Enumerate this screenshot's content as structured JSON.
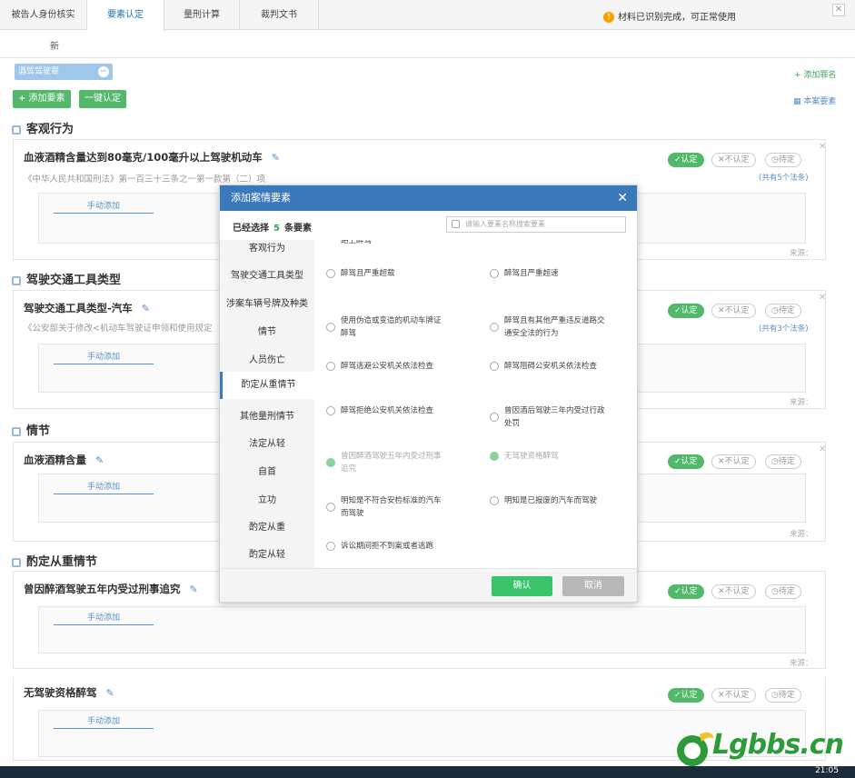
{
  "tabs": [
    "被告人身份核实",
    "要素认定",
    "量刑计算",
    "裁判文书"
  ],
  "notice": "材料已识别完成，可正常使用",
  "subtab": "新",
  "chip": "酒驾驾驶罪",
  "add_group": "+ 添加罪名",
  "btn_add": "+ 添加要素",
  "btn_confirm": "一键认定",
  "layout_label": "本案要素",
  "manual_add": "手动添加",
  "status": {
    "ok": "✓认定",
    "no": "✕不认定",
    "pending": "◷待定"
  },
  "law_count": "(共有5个法条)",
  "law_count2": "(共有3个法条)",
  "source": "来源：",
  "sections": [
    {
      "title": "客观行为",
      "cards": [
        {
          "title": "血液酒精含量达到80毫克/100毫升以上驾驶机动车",
          "law": "《中华人民共和国刑法》第一百三十三条之一第一款第（二）项"
        }
      ]
    },
    {
      "title": "驾驶交通工具类型",
      "cards": [
        {
          "title": "驾驶交通工具类型-汽车",
          "law": "《公安部关于修改<机动车驾驶证申领和使用规定"
        }
      ]
    },
    {
      "title": "情节",
      "cards": [
        {
          "title": "血液酒精含量",
          "law": ""
        }
      ]
    },
    {
      "title": "酌定从重情节",
      "cards": [
        {
          "title": "曾因醉酒驾驶五年内受过刑事追究",
          "law": ""
        },
        {
          "title": "无驾驶资格醉驾",
          "law": ""
        }
      ]
    }
  ],
  "modal": {
    "title": "添加案情要素",
    "selected_prefix": "已经选择",
    "selected_count": "5",
    "selected_suffix": "条要素",
    "search_placeholder": "请输入要素名称搜索要素",
    "menu": [
      "客观行为",
      "驾驶交通工具类型",
      "涉案车辆号牌及种类",
      "情节",
      "人员伤亡",
      "酌定从重情节",
      "其他量刑情节",
      "法定从轻",
      "自首",
      "立功",
      "酌定从重",
      "酌定从轻"
    ],
    "active_menu": "酌定从重情节",
    "top_cut": "路上醉驾",
    "options": [
      [
        "醉驾且严重超载",
        "醉驾且严重超速"
      ],
      [
        "使用伪造或变造的机动车牌证醉驾",
        "醉驾且有其他严重违反道路交通安全法的行为"
      ],
      [
        "醉驾逃避公安机关依法检查",
        "醉驾阻碍公安机关依法检查"
      ],
      [
        "醉驾拒绝公安机关依法检查",
        "曾因酒后驾驶三年内受过行政处罚"
      ],
      [
        "曾因醉酒驾驶五年内受过刑事追究",
        "无驾驶资格醉驾"
      ],
      [
        "明知是不符合安检标准的汽车而驾驶",
        "明知是已报废的汽车而驾驶"
      ],
      [
        "诉讼期间拒不到案或者逃跑",
        ""
      ]
    ],
    "ok": "确认",
    "cancel": "取消"
  },
  "logo_text": "Lgbbs.cn",
  "clock": "21:05",
  "colors": {
    "accent": "#3c79bb",
    "green": "#52b96a"
  }
}
